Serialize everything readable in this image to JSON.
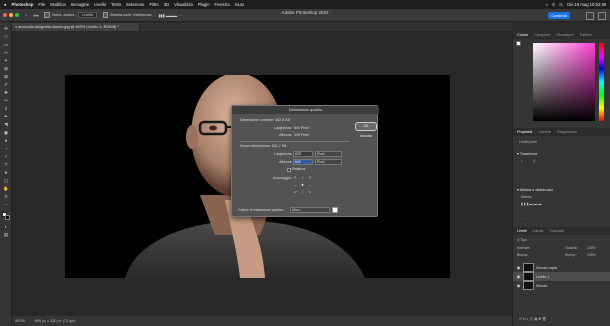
{
  "menubar": {
    "apple": "",
    "items": [
      "Photoshop",
      "File",
      "Modifica",
      "Immagine",
      "Livello",
      "Testo",
      "Selezione",
      "Filtro",
      "3D",
      "Visualizza",
      "Plugin",
      "Finestra",
      "Aiuto"
    ],
    "clock": "Gio 19 mag  10:52:38"
  },
  "window": {
    "title": "Adobe Photoshop 2022",
    "share_label": "Condividi"
  },
  "optionsbar": {
    "autoselect_label": "Selez. autom.:",
    "autoselect_value": "Livello",
    "transform_label": "Mostra contr. trasformaz."
  },
  "document": {
    "tab_label": "aranzulla-fotografia-sfondo.jpg @ 400% (Livello 1, RGB/8) *"
  },
  "status": {
    "zoom": "400%",
    "size": "890 px x 330 px (72 ppi)"
  },
  "dialog": {
    "title": "Dimensione quadro",
    "current_label": "Dimensione corrente: 582,5 KB",
    "width_label": "Larghezza:",
    "width_value": "800 Pixel",
    "height_label": "Altezza:",
    "height_value": "328 Pixel",
    "new_label": "Nuova dimensione: 531,7 KB",
    "new_width_label": "Larghezza:",
    "new_width_value": "825",
    "new_width_unit": "Pixel",
    "new_height_label": "Altezza:",
    "new_height_value": "540",
    "new_height_unit": "Pixel",
    "relative_label": "Relativa",
    "anchor_label": "Ancoraggio:",
    "extension_label": "Colore di estensione quadro:",
    "extension_value": "Altro...",
    "ok_label": "OK",
    "cancel_label": "Annulla"
  },
  "panels": {
    "color_tabs": [
      "Colore",
      "Campioni",
      "Sfumature",
      "Pattern"
    ],
    "properties_tabs": [
      "Proprietà",
      "Librerie",
      "Regolazioni"
    ],
    "pixel_layer": "Livello pixel",
    "transform": "Trasforma",
    "align": "Allinea e distribuisci",
    "align_sub": "Allinea:",
    "layers_tabs": [
      "Livelli",
      "Canali",
      "Tracciati"
    ],
    "filter": "Tipo",
    "blend": "Normale",
    "opacity_label": "Opacità:",
    "opacity_value": "100%",
    "lock_label": "Blocca:",
    "fill_label": "Riemp.:",
    "fill_value": "100%",
    "layers": [
      "Sfondo copia",
      "Livello 1",
      "Sfondo"
    ]
  },
  "colors": {
    "accent": "#1473e6",
    "traffic": [
      "#fe5f57",
      "#febc2e",
      "#28c840"
    ]
  }
}
